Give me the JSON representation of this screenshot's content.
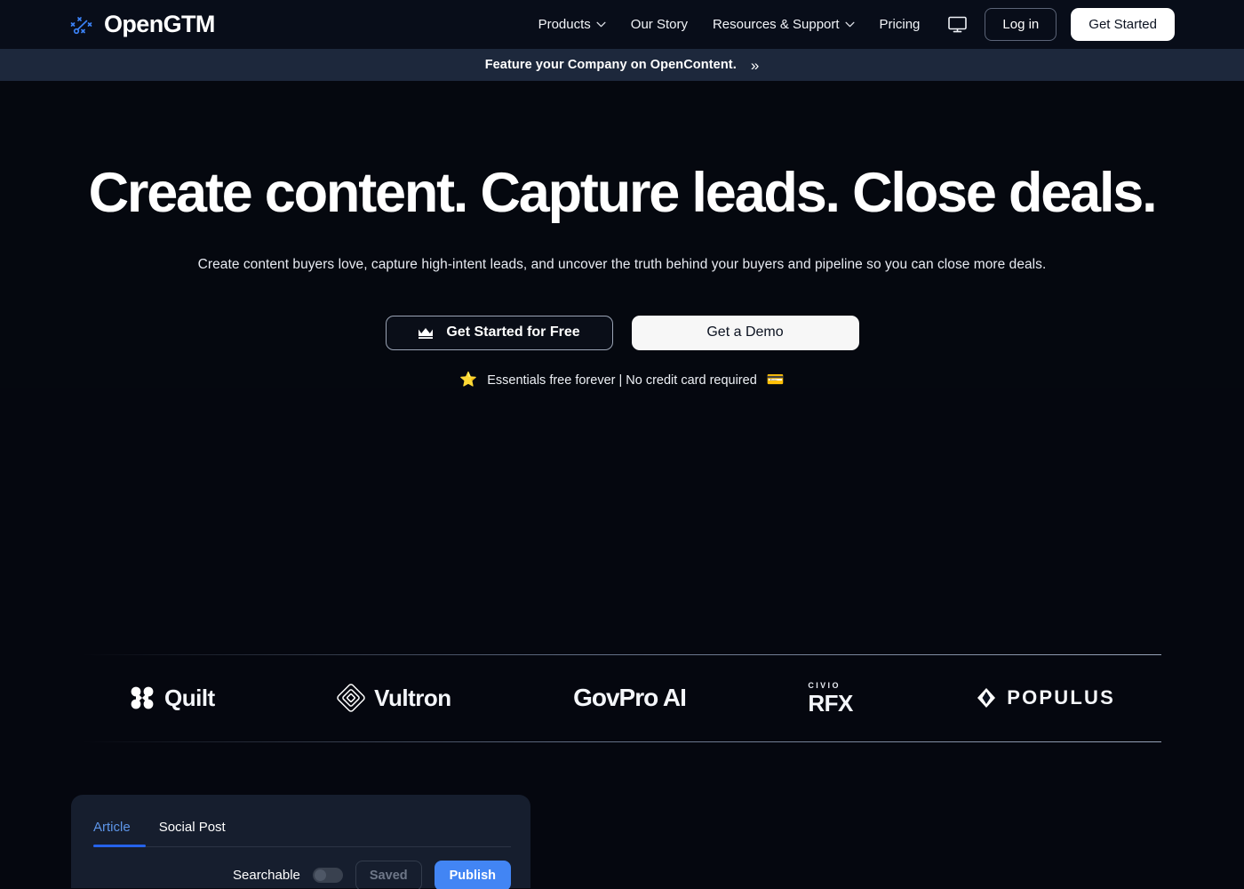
{
  "brand": {
    "name": "OpenGTM",
    "icon": "playbook-strategy-icon",
    "accent_color": "#3b82f6"
  },
  "header": {
    "nav": [
      {
        "label": "Products",
        "has_chevron": true
      },
      {
        "label": "Our Story",
        "has_chevron": false
      },
      {
        "label": "Resources & Support",
        "has_chevron": true
      },
      {
        "label": "Pricing",
        "has_chevron": false
      }
    ],
    "monitor_icon": "monitor-icon",
    "login_label": "Log in",
    "get_started_label": "Get Started"
  },
  "announcement": {
    "text": "Feature your Company on OpenContent.",
    "arrow": "»",
    "background": "#1d283c"
  },
  "hero": {
    "headline": "Create content. Capture leads. Close deals.",
    "subheadline": "Create content buyers love, capture high-intent leads, and uncover the truth behind your buyers and pipeline so you can close more deals.",
    "primary_cta": "Get Started for Free",
    "primary_cta_icon": "crown-icon",
    "secondary_cta": "Get a Demo",
    "note": "Essentials free forever | No credit card required",
    "note_star": "⭐",
    "note_card": "💳"
  },
  "logos": [
    {
      "name": "Quilt",
      "mark": "quilt-flower-icon"
    },
    {
      "name": "Vultron",
      "mark": "vultron-diamond-icon"
    },
    {
      "name": "GovPro AI",
      "mark": "none"
    },
    {
      "name": "RFX",
      "sub": "CIVIO",
      "mark": "none"
    },
    {
      "name": "POPULUS",
      "mark": "populus-diamond-icon"
    }
  ],
  "editor_card": {
    "tabs": [
      {
        "label": "Article",
        "active": true
      },
      {
        "label": "Social Post",
        "active": false
      }
    ],
    "searchable_label": "Searchable",
    "searchable_on": false,
    "saved_label": "Saved",
    "publish_label": "Publish",
    "publish_color": "#4285f4",
    "active_tab_color": "#5d95e8"
  }
}
